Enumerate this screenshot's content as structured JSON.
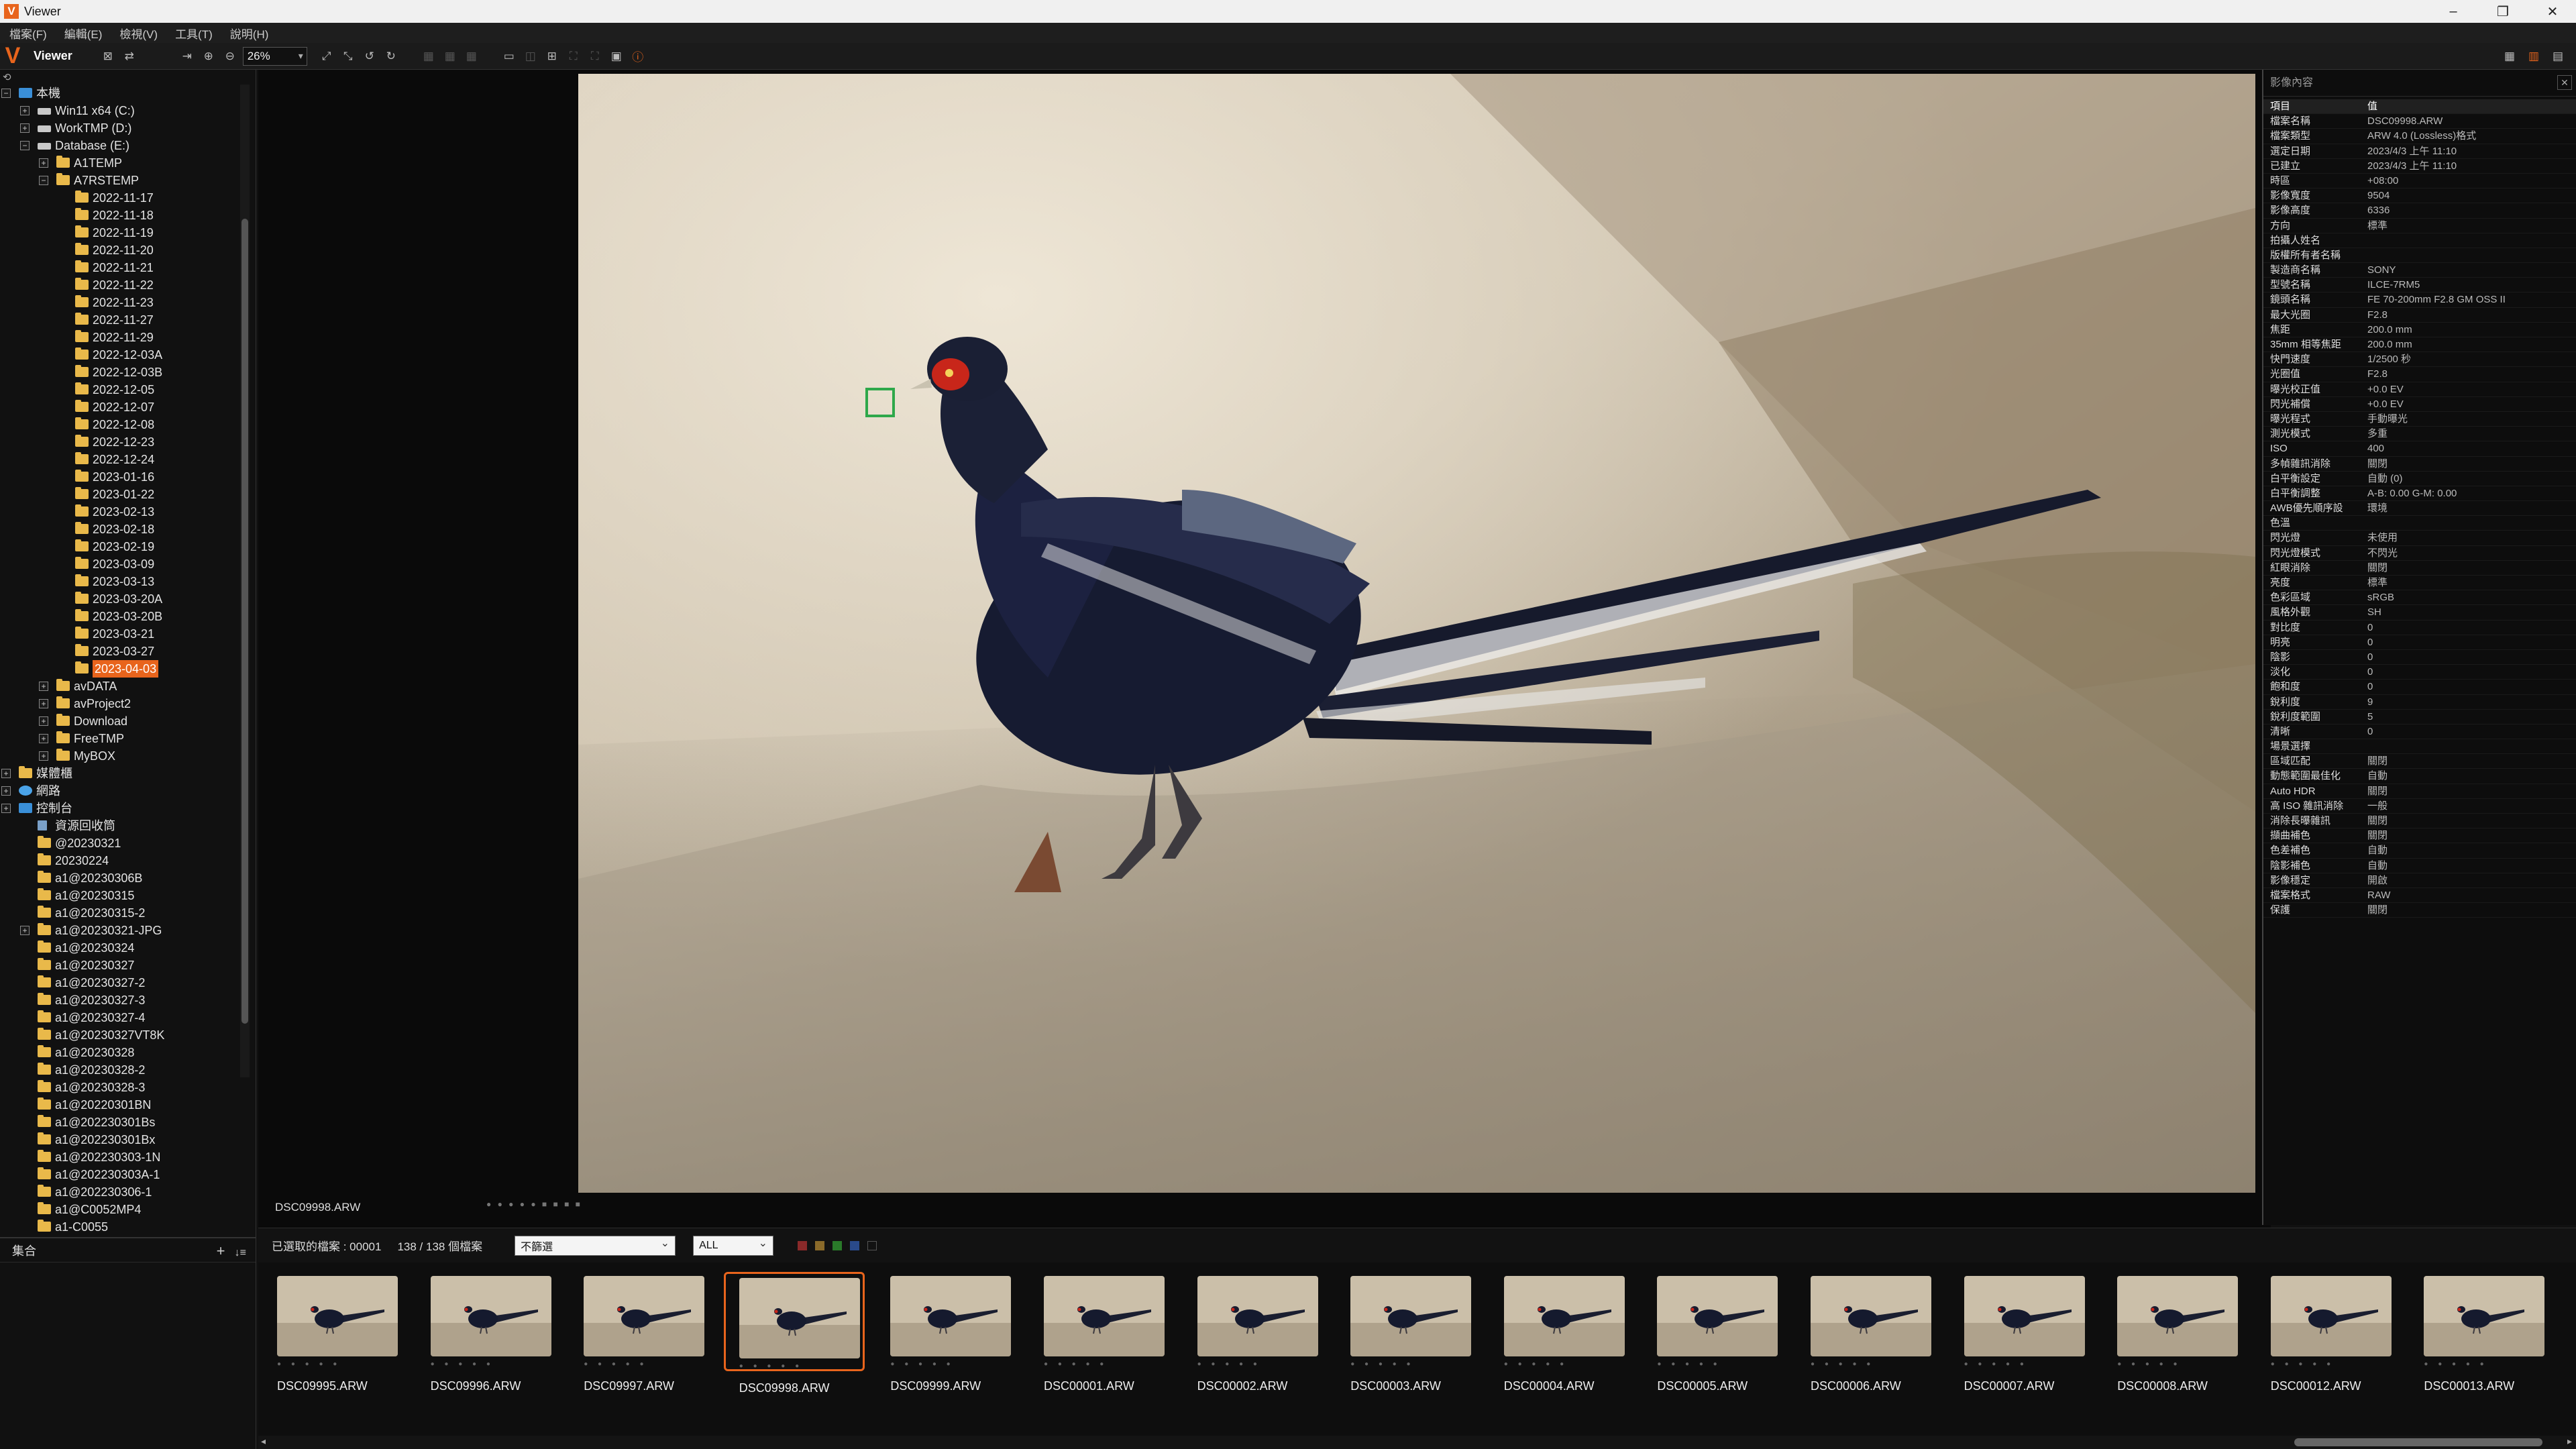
{
  "window": {
    "title": "Viewer",
    "logo_letter": "V"
  },
  "menu": [
    "檔案(F)",
    "編輯(E)",
    "檢視(V)",
    "工具(T)",
    "說明(H)"
  ],
  "toolbar": {
    "app_name": "Viewer",
    "zoom": "26%"
  },
  "tree": [
    {
      "label": "本機",
      "depth": 0,
      "exp": "−",
      "icon": "pc"
    },
    {
      "label": "Win11 x64 (C:)",
      "depth": 1,
      "exp": "+",
      "icon": "drive"
    },
    {
      "label": "WorkTMP (D:)",
      "depth": 1,
      "exp": "+",
      "icon": "drive"
    },
    {
      "label": "Database (E:)",
      "depth": 1,
      "exp": "−",
      "icon": "drive"
    },
    {
      "label": "A1TEMP",
      "depth": 2,
      "exp": "+",
      "icon": "folder"
    },
    {
      "label": "A7RSTEMP",
      "depth": 2,
      "exp": "−",
      "icon": "folder"
    },
    {
      "label": "2022-11-17",
      "depth": 3,
      "icon": "folder"
    },
    {
      "label": "2022-11-18",
      "depth": 3,
      "icon": "folder"
    },
    {
      "label": "2022-11-19",
      "depth": 3,
      "icon": "folder"
    },
    {
      "label": "2022-11-20",
      "depth": 3,
      "icon": "folder"
    },
    {
      "label": "2022-11-21",
      "depth": 3,
      "icon": "folder"
    },
    {
      "label": "2022-11-22",
      "depth": 3,
      "icon": "folder"
    },
    {
      "label": "2022-11-23",
      "depth": 3,
      "icon": "folder"
    },
    {
      "label": "2022-11-27",
      "depth": 3,
      "icon": "folder"
    },
    {
      "label": "2022-11-29",
      "depth": 3,
      "icon": "folder"
    },
    {
      "label": "2022-12-03A",
      "depth": 3,
      "icon": "folder"
    },
    {
      "label": "2022-12-03B",
      "depth": 3,
      "icon": "folder"
    },
    {
      "label": "2022-12-05",
      "depth": 3,
      "icon": "folder"
    },
    {
      "label": "2022-12-07",
      "depth": 3,
      "icon": "folder"
    },
    {
      "label": "2022-12-08",
      "depth": 3,
      "icon": "folder"
    },
    {
      "label": "2022-12-23",
      "depth": 3,
      "icon": "folder"
    },
    {
      "label": "2022-12-24",
      "depth": 3,
      "icon": "folder"
    },
    {
      "label": "2023-01-16",
      "depth": 3,
      "icon": "folder"
    },
    {
      "label": "2023-01-22",
      "depth": 3,
      "icon": "folder"
    },
    {
      "label": "2023-02-13",
      "depth": 3,
      "icon": "folder"
    },
    {
      "label": "2023-02-18",
      "depth": 3,
      "icon": "folder"
    },
    {
      "label": "2023-02-19",
      "depth": 3,
      "icon": "folder"
    },
    {
      "label": "2023-03-09",
      "depth": 3,
      "icon": "folder"
    },
    {
      "label": "2023-03-13",
      "depth": 3,
      "icon": "folder"
    },
    {
      "label": "2023-03-20A",
      "depth": 3,
      "icon": "folder"
    },
    {
      "label": "2023-03-20B",
      "depth": 3,
      "icon": "folder"
    },
    {
      "label": "2023-03-21",
      "depth": 3,
      "icon": "folder"
    },
    {
      "label": "2023-03-27",
      "depth": 3,
      "icon": "folder"
    },
    {
      "label": "2023-04-03",
      "depth": 3,
      "icon": "folder",
      "selected": true
    },
    {
      "label": "avDATA",
      "depth": 2,
      "exp": "+",
      "icon": "folder"
    },
    {
      "label": "avProject2",
      "depth": 2,
      "exp": "+",
      "icon": "folder"
    },
    {
      "label": "Download",
      "depth": 2,
      "exp": "+",
      "icon": "folder"
    },
    {
      "label": "FreeTMP",
      "depth": 2,
      "exp": "+",
      "icon": "folder"
    },
    {
      "label": "MyBOX",
      "depth": 2,
      "exp": "+",
      "icon": "folder"
    },
    {
      "label": "媒體櫃",
      "depth": 0,
      "exp": "+",
      "icon": "folder"
    },
    {
      "label": "網路",
      "depth": 0,
      "exp": "+",
      "icon": "net"
    },
    {
      "label": "控制台",
      "depth": 0,
      "exp": "+",
      "icon": "pc"
    },
    {
      "label": "資源回收筒",
      "depth": 1,
      "icon": "bin"
    },
    {
      "label": "@20230321",
      "depth": 1,
      "icon": "folder"
    },
    {
      "label": "20230224",
      "depth": 1,
      "icon": "folder"
    },
    {
      "label": "a1@20230306B",
      "depth": 1,
      "icon": "folder"
    },
    {
      "label": "a1@20230315",
      "depth": 1,
      "icon": "folder"
    },
    {
      "label": "a1@20230315-2",
      "depth": 1,
      "icon": "folder"
    },
    {
      "label": "a1@20230321-JPG",
      "depth": 1,
      "exp": "+",
      "icon": "folder"
    },
    {
      "label": "a1@20230324",
      "depth": 1,
      "icon": "folder"
    },
    {
      "label": "a1@20230327",
      "depth": 1,
      "icon": "folder"
    },
    {
      "label": "a1@20230327-2",
      "depth": 1,
      "icon": "folder"
    },
    {
      "label": "a1@20230327-3",
      "depth": 1,
      "icon": "folder"
    },
    {
      "label": "a1@20230327-4",
      "depth": 1,
      "icon": "folder"
    },
    {
      "label": "a1@20230327VT8K",
      "depth": 1,
      "icon": "folder"
    },
    {
      "label": "a1@20230328",
      "depth": 1,
      "icon": "folder"
    },
    {
      "label": "a1@20230328-2",
      "depth": 1,
      "icon": "folder"
    },
    {
      "label": "a1@20230328-3",
      "depth": 1,
      "icon": "folder"
    },
    {
      "label": "a1@2022030​1BN",
      "depth": 1,
      "icon": "folder"
    },
    {
      "label": "a1@20223030​1Bs",
      "depth": 1,
      "icon": "folder"
    },
    {
      "label": "a1@20223030​1Bx",
      "depth": 1,
      "icon": "folder"
    },
    {
      "label": "a1@20223030​3-1N",
      "depth": 1,
      "icon": "folder"
    },
    {
      "label": "a1@20223030​3A-1",
      "depth": 1,
      "icon": "folder"
    },
    {
      "label": "a1@20223030​6-1",
      "depth": 1,
      "icon": "folder"
    },
    {
      "label": "a1@C0052MP4",
      "depth": 1,
      "icon": "folder"
    },
    {
      "label": "a1-C0055",
      "depth": 1,
      "icon": "folder"
    }
  ],
  "collections": {
    "title": "集合",
    "add": "+",
    "sort": "↓≡"
  },
  "viewer": {
    "filename": "DSC09998.ARW"
  },
  "info_panel": {
    "title": "影像內容",
    "col_key": "項目",
    "col_val": "值",
    "rows": [
      [
        "檔案名稱",
        "DSC09998.ARW"
      ],
      [
        "檔案類型",
        "ARW 4.0 (Lossless)格式"
      ],
      [
        "選定日期",
        "2023/4/3 上午 11:10"
      ],
      [
        "已建立",
        "2023/4/3 上午 11:10"
      ],
      [
        "時區",
        "+08:00"
      ],
      [
        "影像寬度",
        "9504"
      ],
      [
        "影像高度",
        "6336"
      ],
      [
        "方向",
        "標準"
      ],
      [
        "拍攝人姓名",
        ""
      ],
      [
        "版權所有者名稱",
        ""
      ],
      [
        "製造商名稱",
        "SONY"
      ],
      [
        "型號名稱",
        "ILCE-7RM5"
      ],
      [
        "鏡頭名稱",
        "FE 70-200mm F2.8 GM OSS II"
      ],
      [
        "最大光圈",
        "F2.8"
      ],
      [
        "焦距",
        "200.0 mm"
      ],
      [
        "35mm 相等焦距",
        "200.0 mm"
      ],
      [
        "快門速度",
        "1/2500 秒"
      ],
      [
        "光圈值",
        "F2.8"
      ],
      [
        "曝光校正值",
        "+0.0 EV"
      ],
      [
        "閃光補償",
        "+0.0 EV"
      ],
      [
        "曝光程式",
        "手動曝光"
      ],
      [
        "測光模式",
        "多重"
      ],
      [
        "ISO",
        "400"
      ],
      [
        "多幀雜訊消除",
        "關閉"
      ],
      [
        "白平衡設定",
        "自動 (0)"
      ],
      [
        "白平衡調整",
        "A-B: 0.00 G-M: 0.00"
      ],
      [
        "AWB優先順序設",
        "環境"
      ],
      [
        "色溫",
        ""
      ],
      [
        "閃光燈",
        "未使用"
      ],
      [
        "閃光燈模式",
        "不閃光"
      ],
      [
        "紅眼消除",
        "關閉"
      ],
      [
        "亮度",
        "標準"
      ],
      [
        "色彩區域",
        "sRGB"
      ],
      [
        "風格外觀",
        "SH"
      ],
      [
        "對比度",
        "0"
      ],
      [
        "明亮",
        "0"
      ],
      [
        "陰影",
        "0"
      ],
      [
        "淡化",
        "0"
      ],
      [
        "飽和度",
        "0"
      ],
      [
        "銳利度",
        "9"
      ],
      [
        "銳利度範圍",
        "5"
      ],
      [
        "清晰",
        "0"
      ],
      [
        "場景選擇",
        ""
      ],
      [
        "區域匹配",
        "關閉"
      ],
      [
        "動態範圍最佳化",
        "自動"
      ],
      [
        "Auto HDR",
        "關閉"
      ],
      [
        "高 ISO 雜訊消除",
        "一般"
      ],
      [
        "消除長曝雜訊",
        "關閉"
      ],
      [
        "擷曲補色",
        "關閉"
      ],
      [
        "色差補色",
        "自動"
      ],
      [
        "陰影補色",
        "自動"
      ],
      [
        "影像穩定",
        "開啟"
      ],
      [
        "檔案格式",
        "RAW"
      ],
      [
        "保護",
        "關閉"
      ]
    ]
  },
  "filterbar": {
    "selected_count": "已選取的檔案 : 00001",
    "file_count": "138 / 138 個檔案",
    "rating_filter": "不篩選",
    "label_filter": "ALL",
    "colors": [
      "#8a2a2a",
      "#8a6a2a",
      "#2a7a2a",
      "#2a4a8a"
    ]
  },
  "thumbnails": [
    {
      "name": "DSC09995.ARW",
      "pose": "a"
    },
    {
      "name": "DSC09996.ARW",
      "pose": "a"
    },
    {
      "name": "DSC09997.ARW",
      "pose": "a"
    },
    {
      "name": "DSC09998.ARW",
      "pose": "b",
      "selected": true
    },
    {
      "name": "DSC09999.ARW",
      "pose": "a"
    },
    {
      "name": "DSC00001.ARW",
      "pose": "a"
    },
    {
      "name": "DSC00002.ARW",
      "pose": "a"
    },
    {
      "name": "DSC00003.ARW",
      "pose": "a"
    },
    {
      "name": "DSC00004.ARW",
      "pose": "a"
    },
    {
      "name": "DSC00005.ARW",
      "pose": "a"
    },
    {
      "name": "DSC00006.ARW",
      "pose": "a"
    },
    {
      "name": "DSC00007.ARW",
      "pose": "a"
    },
    {
      "name": "DSC00008.ARW",
      "pose": "a"
    },
    {
      "name": "DSC00012.ARW",
      "pose": "a"
    },
    {
      "name": "DSC00013.ARW",
      "pose": "c"
    }
  ]
}
